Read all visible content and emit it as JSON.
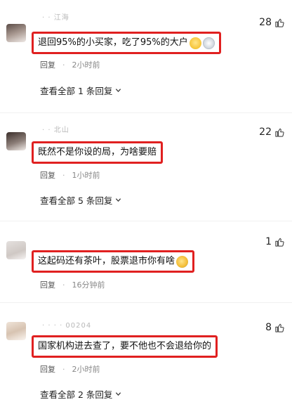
{
  "comments": [
    {
      "username": "· · 江海",
      "text": "退回95%的小买家，吃了95%的大户",
      "likes": "28",
      "reply_label": "回复",
      "time": "2小时前",
      "view_replies": "查看全部 1 条回复",
      "emojis": [
        "smile-emoji",
        "cat-emoji"
      ]
    },
    {
      "username": "· · 北山",
      "text": "既然不是你设的局，为啥要赔",
      "likes": "22",
      "reply_label": "回复",
      "time": "1小时前",
      "view_replies": "查看全部 5 条回复",
      "emojis": []
    },
    {
      "username": "",
      "text": "这起码还有茶叶，股票退市你有啥",
      "likes": "1",
      "reply_label": "回复",
      "time": "16分钟前",
      "view_replies": "",
      "emojis": [
        "cry-laugh-emoji"
      ]
    },
    {
      "username": "· · · · 00204",
      "text": "国家机构进去查了，要不他也不会退给你的",
      "likes": "8",
      "reply_label": "回复",
      "time": "2小时前",
      "view_replies": "查看全部 2 条回复",
      "emojis": []
    }
  ],
  "colors": {
    "highlight_border": "#e02020",
    "meta_text": "#888888",
    "body_text": "#111111"
  },
  "icons": {
    "like": "thumbs-up-icon",
    "expand": "chevron-down-icon"
  }
}
